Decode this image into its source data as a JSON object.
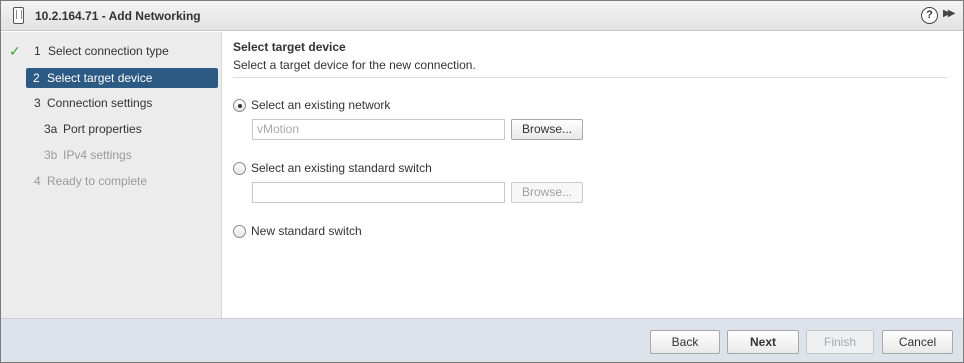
{
  "window": {
    "title": "10.2.164.71 - Add Networking",
    "help_glyph": "?",
    "expand_glyph": "▶▶"
  },
  "nav": {
    "check_glyph": "✓",
    "steps": [
      {
        "num": "1",
        "label": "Select connection type",
        "state": "completed"
      },
      {
        "num": "2",
        "label": "Select target device",
        "state": "active"
      },
      {
        "num": "3",
        "label": "Connection settings",
        "state": "pending"
      },
      {
        "num": "3a",
        "label": "Port properties",
        "state": "pending"
      },
      {
        "num": "3b",
        "label": "IPv4 settings",
        "state": "disabled"
      },
      {
        "num": "4",
        "label": "Ready to complete",
        "state": "disabled"
      }
    ]
  },
  "content": {
    "title": "Select target device",
    "description": "Select a target device for the new connection.",
    "options": [
      {
        "label": "Select an existing network",
        "selected": true,
        "field_value": "vMotion",
        "browse_label": "Browse...",
        "browse_enabled": true
      },
      {
        "label": "Select an existing standard switch",
        "selected": false,
        "field_value": "",
        "browse_label": "Browse...",
        "browse_enabled": false
      },
      {
        "label": "New standard switch",
        "selected": false
      }
    ]
  },
  "footer": {
    "back": "Back",
    "next": "Next",
    "finish": "Finish",
    "cancel": "Cancel"
  },
  "colors": {
    "active_step_bg": "#2d5a83",
    "check": "#3aa53a",
    "footer_bg": "#dde3ea"
  }
}
